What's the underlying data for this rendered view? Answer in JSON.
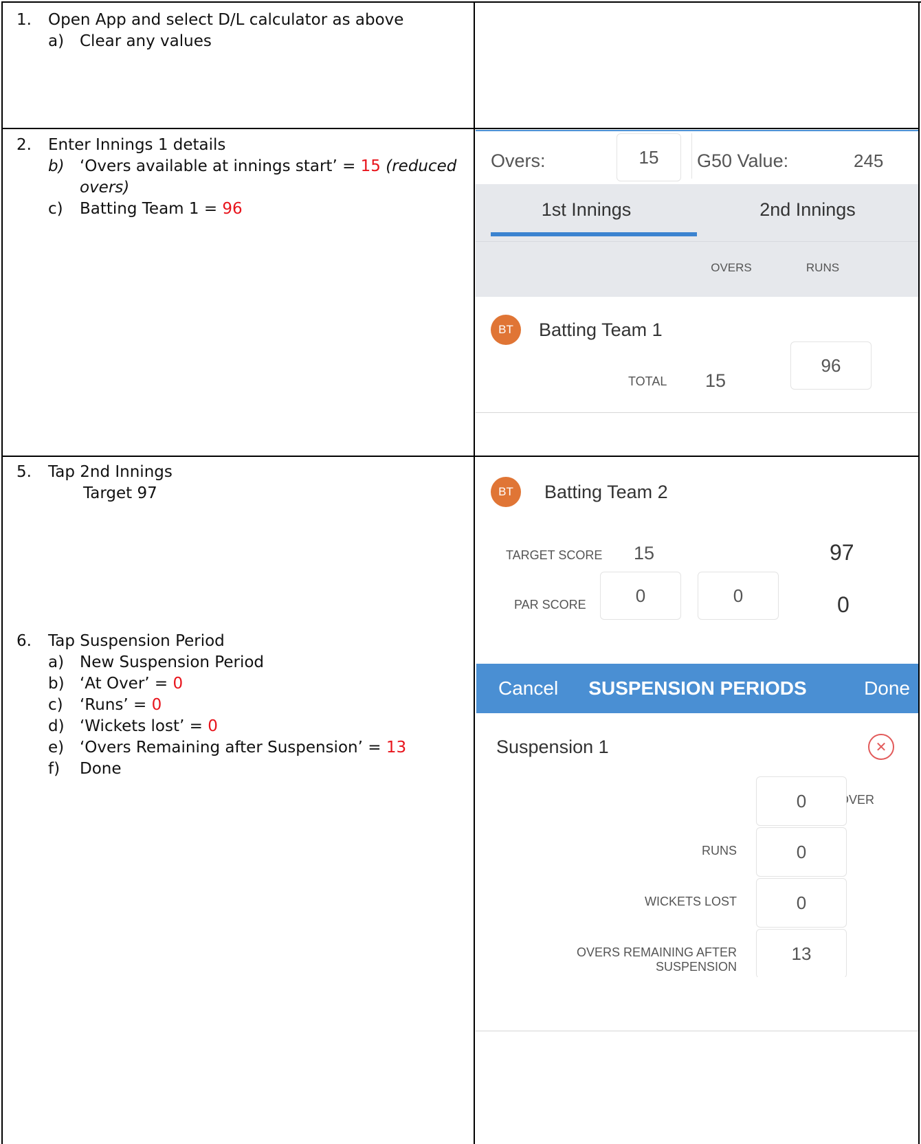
{
  "steps": {
    "s1": {
      "num": "1.",
      "text": "Open App and select D/L calculator as above",
      "a": {
        "letter": "a)",
        "text": "Clear any values"
      }
    },
    "s2": {
      "num": "2.",
      "text": "Enter Innings 1 details",
      "b": {
        "letter": "b)",
        "pre": "‘Overs available at innings start’ = ",
        "val": "15",
        "post": " (reduced",
        "post2": "overs)"
      },
      "c": {
        "letter": "c)",
        "pre": "Batting Team 1 = ",
        "val": "96"
      }
    },
    "s5": {
      "num": "5.",
      "text": "Tap 2nd Innings",
      "line2": "Target 97"
    },
    "s6": {
      "num": "6.",
      "text": "Tap Suspension Period",
      "items": [
        {
          "letter": "a)",
          "pre": "New Suspension Period",
          "val": ""
        },
        {
          "letter": "b)",
          "pre": "‘At Over’ = ",
          "val": "0"
        },
        {
          "letter": "c)",
          "pre": "‘Runs’ = ",
          "val": "0"
        },
        {
          "letter": "d)",
          "pre": "‘Wickets lost’ = ",
          "val": "0"
        },
        {
          "letter": "e)",
          "pre": "‘Overs Remaining after Suspension’ = ",
          "val": "13"
        },
        {
          "letter": "f)",
          "pre": "Done",
          "val": ""
        }
      ]
    }
  },
  "screen1": {
    "overs_label": "Overs:",
    "overs_value": "15",
    "g50_label": "G50 Value:",
    "g50_value": "245",
    "tab1": "1st Innings",
    "tab2": "2nd Innings",
    "col_overs": "OVERS",
    "col_runs": "RUNS",
    "avatar": "BT",
    "team": "Batting Team 1",
    "total_label": "TOTAL",
    "total_overs": "15",
    "total_runs": "96"
  },
  "screen2": {
    "avatar": "BT",
    "team": "Batting Team 2",
    "target_label": "TARGET SCORE",
    "target_overs": "15",
    "target_runs": "97",
    "par_label": "PAR SCORE",
    "par_overs": "0",
    "par_wickets": "0",
    "par_runs": "0"
  },
  "screen3": {
    "cancel": "Cancel",
    "title": "SUSPENSION PERIODS",
    "done": "Done",
    "suspension_name": "Suspension 1",
    "fields": [
      {
        "label": "AT OVER",
        "value": "0"
      },
      {
        "label": "RUNS",
        "value": "0"
      },
      {
        "label": "WICKETS LOST",
        "value": "0"
      },
      {
        "label": "OVERS REMAINING AFTER SUSPENSION",
        "value": "13"
      }
    ]
  },
  "colors": {
    "accent_blue": "#4a8fd3",
    "tab_underline": "#3b83d0",
    "avatar_orange": "#e07535",
    "highlight_red": "#e8141c"
  }
}
